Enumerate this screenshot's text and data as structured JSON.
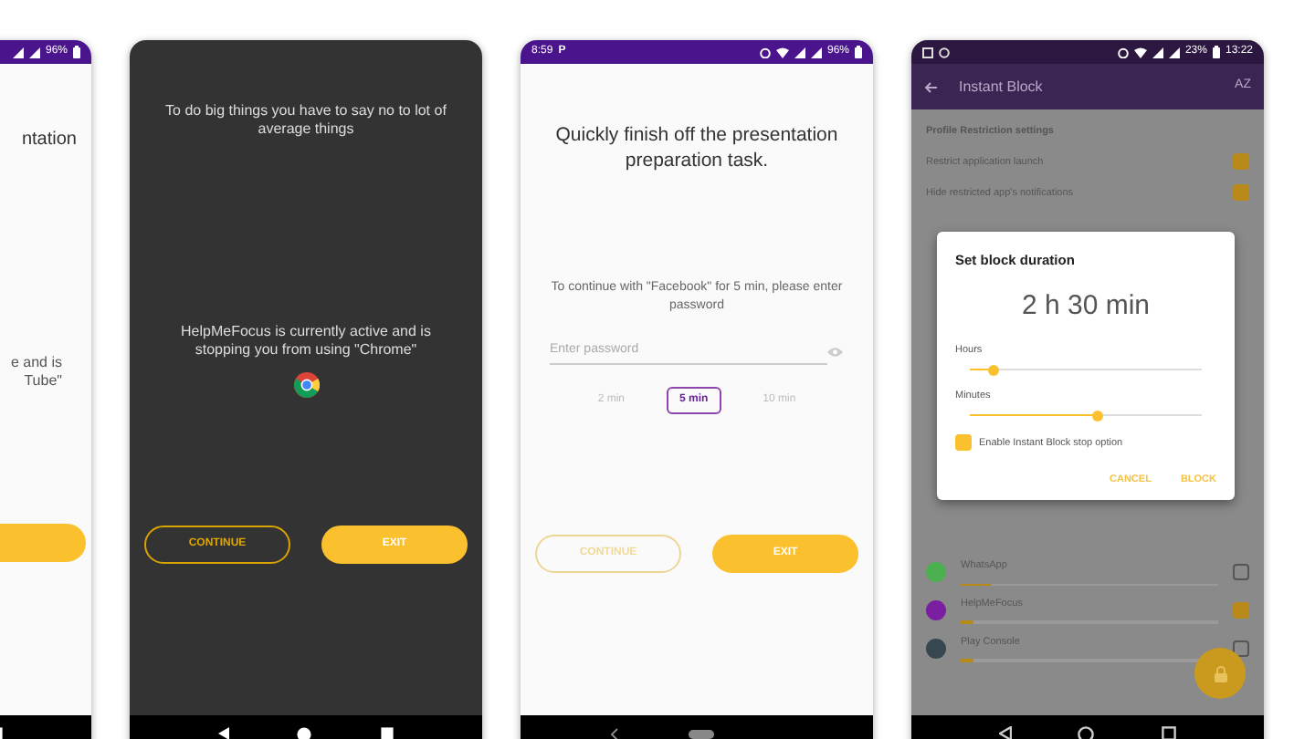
{
  "phones": [
    {
      "kind": "partial",
      "status": {
        "battery": "96%"
      },
      "texts": [
        "ntation",
        "e and is",
        "Tube\""
      ]
    },
    {
      "kind": "blocker",
      "quote": "To do big things you have to say no to lot of average things",
      "message": "HelpMeFocus is currently active and is stopping you from using \"Chrome\"",
      "buttons": [
        {
          "label": "CONTINUE",
          "kind": "outline",
          "disabled": false
        },
        {
          "label": "EXIT",
          "kind": "fill",
          "disabled": false
        }
      ]
    },
    {
      "kind": "password",
      "status": {
        "time": "8:59",
        "carrier": "P",
        "battery": "96%"
      },
      "task": "Quickly finish off the presentation preparation task.",
      "prompt": "To continue with \"Facebook\" for 5 min, please enter password",
      "password": {
        "placeholder": "Enter password"
      },
      "durations": [
        {
          "label": "2 min",
          "selected": false
        },
        {
          "label": "5 min",
          "selected": true
        },
        {
          "label": "10 min",
          "selected": false
        }
      ],
      "buttons": [
        {
          "label": "CONTINUE",
          "kind": "outline",
          "disabled": true
        },
        {
          "label": "EXIT",
          "kind": "fill",
          "disabled": false
        }
      ]
    },
    {
      "kind": "instant",
      "status": {
        "battery": "23%",
        "time": "13:22"
      },
      "title": "Instant Block",
      "sort": "AZ",
      "section": "Profile Restriction settings",
      "settings": [
        {
          "label": "Restrict application launch",
          "checked": true
        },
        {
          "label": "Hide restricted app's notifications",
          "checked": true
        }
      ],
      "apps": [
        {
          "name": "WhatsApp",
          "checked": false,
          "color": "#4caf50",
          "level": 0.12
        },
        {
          "name": "HelpMeFocus",
          "checked": true,
          "color": "#7b1fa2",
          "level": 0.05
        },
        {
          "name": "Play Console",
          "checked": false,
          "color": "#37474f",
          "level": 0.05
        }
      ],
      "dialog": {
        "title": "Set block duration",
        "duration": "2 h 30 min",
        "sliders": [
          {
            "label": "Hours",
            "level": 0.1
          },
          {
            "label": "Minutes",
            "level": 0.55
          }
        ],
        "option": {
          "label": "Enable Instant Block stop option",
          "checked": true
        },
        "actions": [
          "CANCEL",
          "BLOCK"
        ]
      }
    }
  ]
}
